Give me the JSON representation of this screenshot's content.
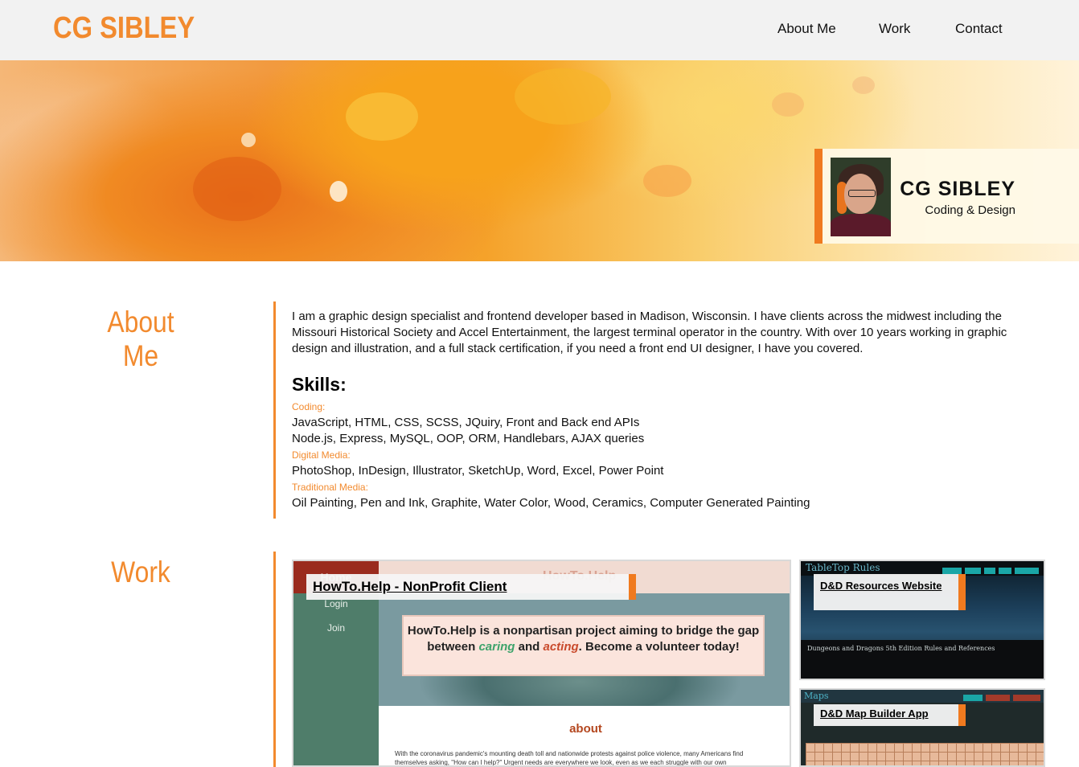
{
  "nav": {
    "brand": "CG SIBLEY",
    "links": [
      {
        "label": "About Me"
      },
      {
        "label": "Work"
      },
      {
        "label": "Contact"
      }
    ]
  },
  "hero": {
    "name": "CG SIBLEY",
    "tagline": "Coding & Design"
  },
  "about": {
    "title": "About Me",
    "bio": "I am a graphic design specialist and frontend developer based in Madison, Wisconsin. I have clients across the midwest including the Missouri Historical Society and Accel Entertainment, the largest terminal operator in the country. With over 10 years working in graphic design and illustration, and a full stack certification, if you need a front end UI designer, I have you covered.",
    "skills_heading": "Skills:",
    "skills": [
      {
        "category": "Coding:",
        "lines": [
          "JavaScript, HTML, CSS, SCSS, JQuiry, Front and Back end APIs",
          "Node.js, Express, MySQL, OOP, ORM, Handlebars, AJAX queries"
        ]
      },
      {
        "category": "Digital Media:",
        "lines": [
          "PhotoShop, InDesign, Illustrator, SketchUp, Word, Excel, Power Point"
        ]
      },
      {
        "category": "Traditional Media:",
        "lines": [
          "Oil Painting, Pen and Ink, Graphite, Water Color, Wood, Ceramics, Computer Generated Painting"
        ]
      }
    ]
  },
  "work": {
    "title": "Work",
    "projects": [
      {
        "label": "HowTo.Help - NonProfit Client",
        "preview": {
          "side_links": [
            "Home",
            "Login",
            "Join"
          ],
          "ghost_title": "HowTo.Help",
          "message_pre": "HowTo.Help is a nonpartisan project aiming to bridge the gap between",
          "message_caring": "caring",
          "message_and": "and",
          "message_acting": "acting",
          "message_post": ". Become a volunteer today!",
          "about_heading": "about",
          "body": "With the coronavirus pandemic's mounting death toll and nationwide protests against police violence, many Americans find themselves asking, \"How can I help?\" Urgent needs are everywhere we look, even as we each struggle with our own"
        }
      },
      {
        "label": "D&D Resources Website",
        "preview": {
          "title": "TableTop Rules",
          "footer": "Dungeons and Dragons 5th Edition Rules and References"
        }
      },
      {
        "label": "D&D Map Builder App",
        "preview": {
          "title": "Maps"
        }
      }
    ]
  },
  "colors": {
    "accent": "#f28a2e",
    "nav_bg": "#f2f2f2"
  }
}
